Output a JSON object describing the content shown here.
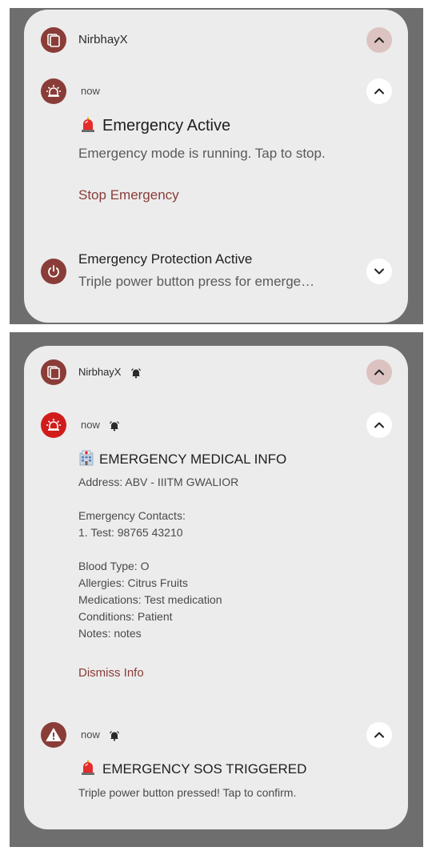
{
  "panel1": {
    "app": {
      "name": "NirbhayX"
    },
    "notif1": {
      "time": "now",
      "title": "Emergency Active",
      "body": "Emergency mode is running. Tap to stop.",
      "action": "Stop Emergency"
    },
    "notif2": {
      "title": "Emergency Protection Active",
      "body": "Triple power button press for emerge…"
    }
  },
  "panel2": {
    "app": {
      "name": "NirbhayX"
    },
    "notif1": {
      "time": "now",
      "title": "EMERGENCY MEDICAL INFO",
      "address": "Address: ABV - IIITM GWALIOR",
      "contacts_heading": "Emergency Contacts:",
      "contact_1": "1. Test: 98765 43210",
      "blood_type": "Blood Type: O",
      "allergies": "Allergies: Citrus Fruits",
      "medications": "Medications: Test medication",
      "conditions": "Conditions: Patient",
      "notes": "Notes: notes",
      "action": "Dismiss Info"
    },
    "notif2": {
      "time": "now",
      "title": "EMERGENCY SOS TRIGGERED",
      "body": "Triple power button pressed! Tap to confirm."
    }
  },
  "colors": {
    "accent": "#8a3d38",
    "alert_red": "#d11c1c",
    "card_bg": "#ececec",
    "backdrop": "#6e6e6e"
  },
  "icons": {
    "app": "app-stack-icon",
    "alarm": "alarm-light-icon",
    "power": "power-icon",
    "warning": "warning-icon",
    "bell": "bell-icon",
    "siren_emoji": "siren-emoji-icon",
    "hospital_emoji": "hospital-emoji-icon",
    "expand_up": "chevron-up-icon",
    "expand_down": "chevron-down-icon"
  }
}
